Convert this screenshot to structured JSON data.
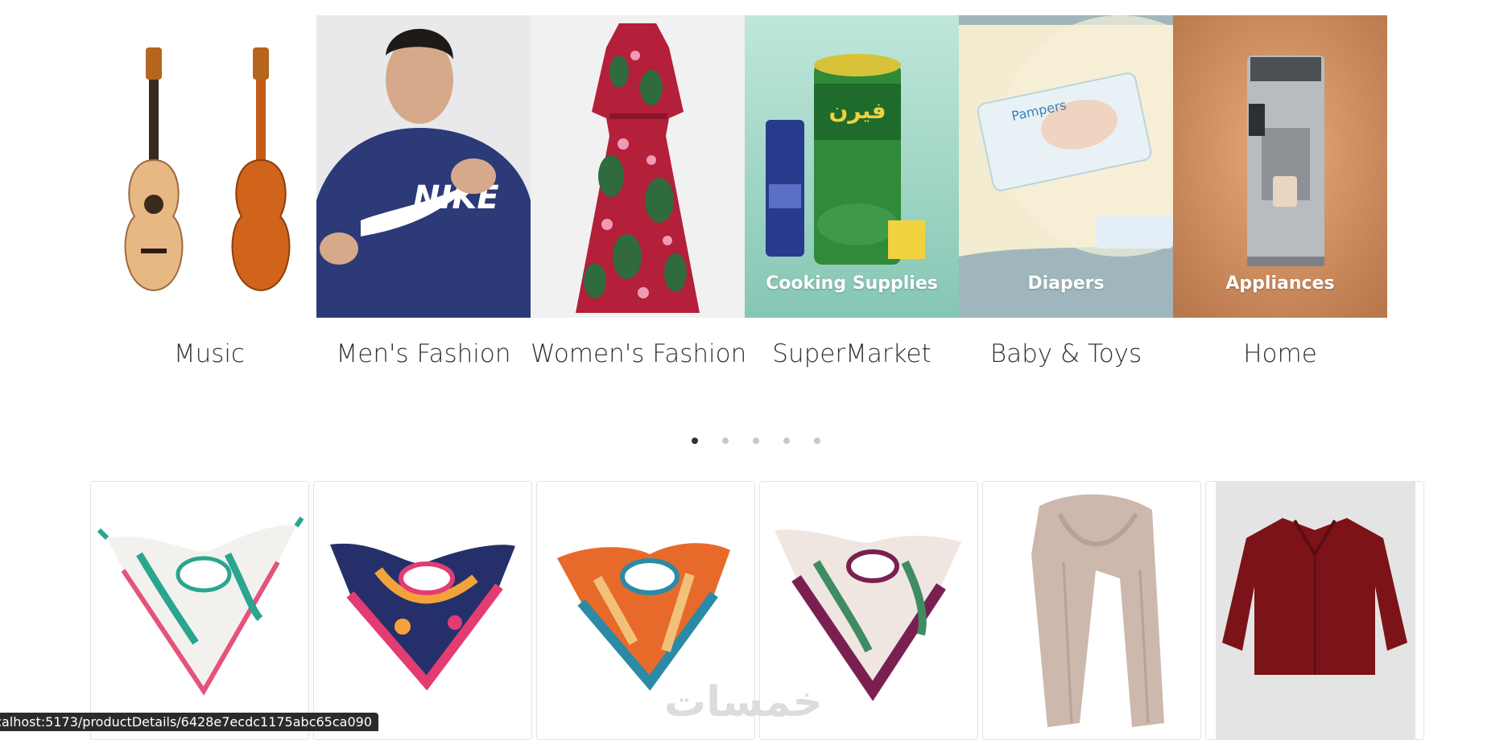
{
  "categories": [
    {
      "label": "Music",
      "overlay": "",
      "icon": "guitar-image"
    },
    {
      "label": "Men's Fashion",
      "overlay": "",
      "icon": "hoodie-model-image"
    },
    {
      "label": "Women's Fashion",
      "overlay": "",
      "icon": "dress-image"
    },
    {
      "label": "SuperMarket",
      "overlay": "Cooking Supplies",
      "icon": "groceries-image"
    },
    {
      "label": "Baby & Toys",
      "overlay": "Diapers",
      "icon": "diapers-image"
    },
    {
      "label": "Home",
      "overlay": "Appliances",
      "icon": "coffee-machine-image"
    }
  ],
  "slider": {
    "dot_count": 5,
    "active_dot": 0
  },
  "products": [
    {
      "name": "scarf-white-teal",
      "colors": [
        "#f3f1ee",
        "#2aa58e",
        "#e4537a"
      ]
    },
    {
      "name": "scarf-navy-pink",
      "colors": [
        "#25306a",
        "#e23c73",
        "#f4a23b"
      ]
    },
    {
      "name": "scarf-orange-teal",
      "colors": [
        "#e86a2b",
        "#2b8aa6",
        "#f2c179"
      ]
    },
    {
      "name": "scarf-plum-green",
      "colors": [
        "#7a2050",
        "#3f8c63",
        "#efe6e2"
      ]
    },
    {
      "name": "scarf-long-beige",
      "colors": [
        "#cdb8ad"
      ]
    },
    {
      "name": "shirt-maroon",
      "colors": [
        "#7b1318"
      ]
    }
  ],
  "watermark": "خمسات",
  "status_url": "ocalhost:5173/productDetails/6428e7ecdc1175abc65ca090"
}
